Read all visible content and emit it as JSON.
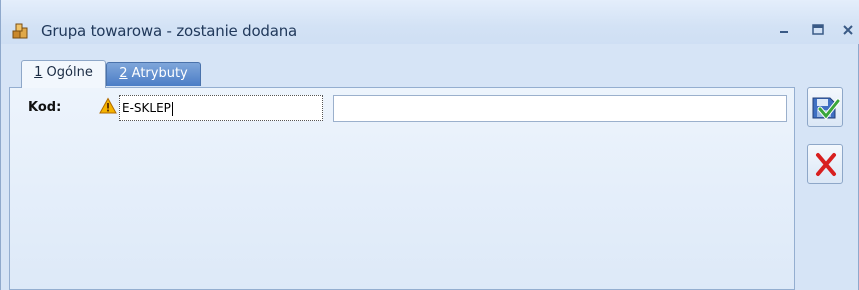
{
  "window": {
    "title": "Grupa towarowa - zostanie dodana",
    "controls": {
      "minimize": "–",
      "maximize": "□",
      "close": "x"
    }
  },
  "tabs": [
    {
      "number": "1",
      "label": " Ogólne",
      "active": true
    },
    {
      "number": "2",
      "label": " Atrybuty",
      "active": false
    }
  ],
  "form": {
    "kod_label": "Kod:",
    "kod_value": "E-SKLEP",
    "name_value": ""
  },
  "icons": {
    "app": "goods-group-icon",
    "warning": "warning-icon",
    "save": "save-checkmark-icon",
    "cancel": "cancel-x-icon"
  },
  "colors": {
    "title_text": "#21395b",
    "tab_inactive": "#4b7dc6",
    "warning": "#f0a500",
    "cancel": "#d81f1f",
    "save_check": "#3aa63a"
  }
}
